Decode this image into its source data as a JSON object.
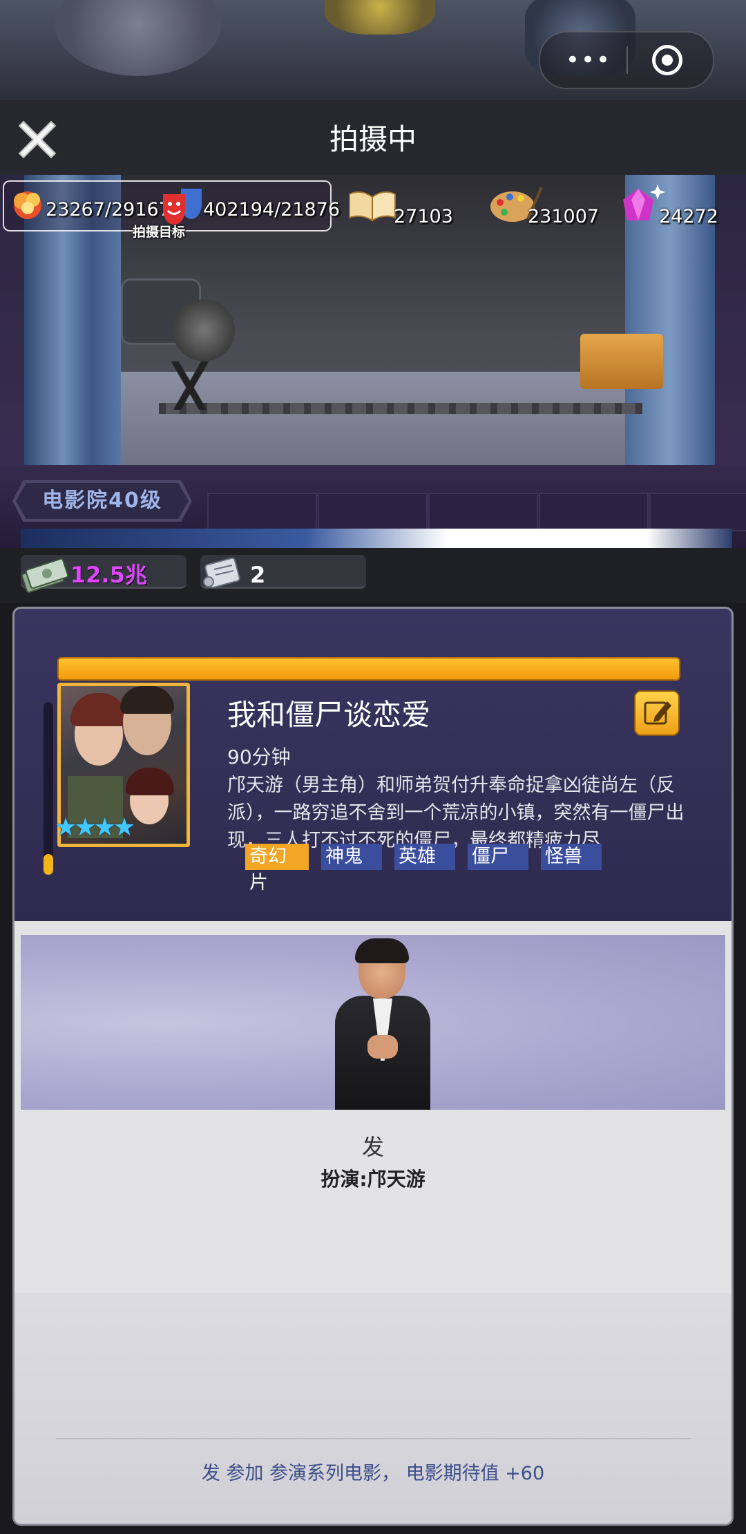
{
  "header": {
    "title": "拍摄中"
  },
  "stats": {
    "audience": "23267/29167",
    "goal_label": "拍摄目标",
    "reputation": "402194/21876",
    "script_points": "27103",
    "art_points": "231007",
    "gems": "24272"
  },
  "cinema": {
    "level_label": "电影院40级"
  },
  "currency": {
    "money": "12.5兆",
    "scripts": "2"
  },
  "movie": {
    "title": "我和僵尸谈恋爱",
    "duration": "90分钟",
    "description": "邝天游（男主角）和师弟贺付升奉命捉拿凶徒尚左（反派），一路穷追不舍到一个荒凉的小镇，突然有一僵尸出现，三人打不过不死的僵尸，最终都精疲力尽",
    "stars": "★★★★",
    "genres": [
      "奇幻片",
      "神鬼",
      "英雄",
      "僵尸",
      "怪兽"
    ]
  },
  "actor": {
    "name": "发",
    "role": "扮演:邝天游",
    "bonus_text": "发  参加 参演系列电影， 电影期待值 +60"
  },
  "colors": {
    "accent_orange": "#f2a623",
    "genre_blue": "#3b4e9e",
    "money_purple": "#e045ff",
    "star_blue": "#41c8ff"
  },
  "icons": {
    "close": "close-icon",
    "more": "more-dots-icon",
    "exit_miniapp": "target-icon",
    "audience": "explosion-icon",
    "reputation": "theater-mask-icon",
    "script": "open-book-icon",
    "art": "palette-icon",
    "gem": "gem-icon",
    "money": "money-stack-icon",
    "scroll": "scroll-icon",
    "edit": "edit-pencil-icon"
  }
}
